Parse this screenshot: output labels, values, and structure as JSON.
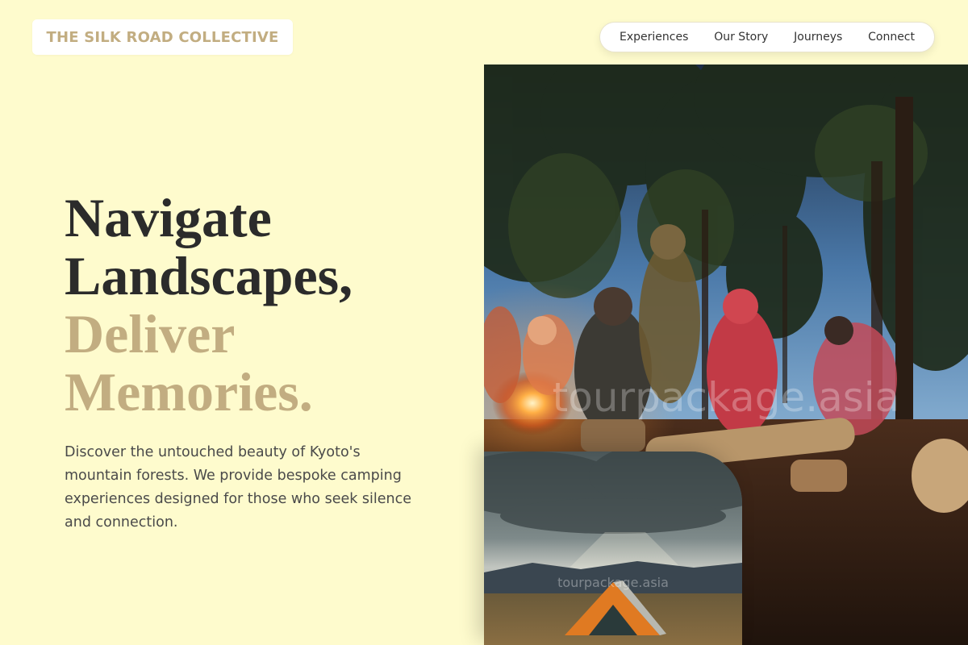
{
  "brand": {
    "name": "THE SILK ROAD COLLECTIVE"
  },
  "nav": {
    "items": [
      {
        "label": "Experiences"
      },
      {
        "label": "Our Story"
      },
      {
        "label": "Journeys"
      },
      {
        "label": "Connect"
      }
    ]
  },
  "hero": {
    "headline": {
      "line1": "Navigate",
      "line2": "Landscapes,",
      "line3": "Deliver",
      "line4": "Memories."
    },
    "lead": "Discover the untouched beauty of Kyoto's mountain forests. We provide bespoke camping experiences designed for those who seek silence and connection.",
    "main_image": {
      "watermark": "tourpackage.asia",
      "subject": "campfire-gathering-forest-night"
    },
    "inset_image": {
      "watermark": "tourpackage.asia",
      "subject": "orange-tent-mountain-valley"
    }
  },
  "colors": {
    "background": "#fefbcd",
    "accent": "#c2ad81",
    "text_dark": "#2b2b2b",
    "text_body": "#4a4a4a"
  }
}
